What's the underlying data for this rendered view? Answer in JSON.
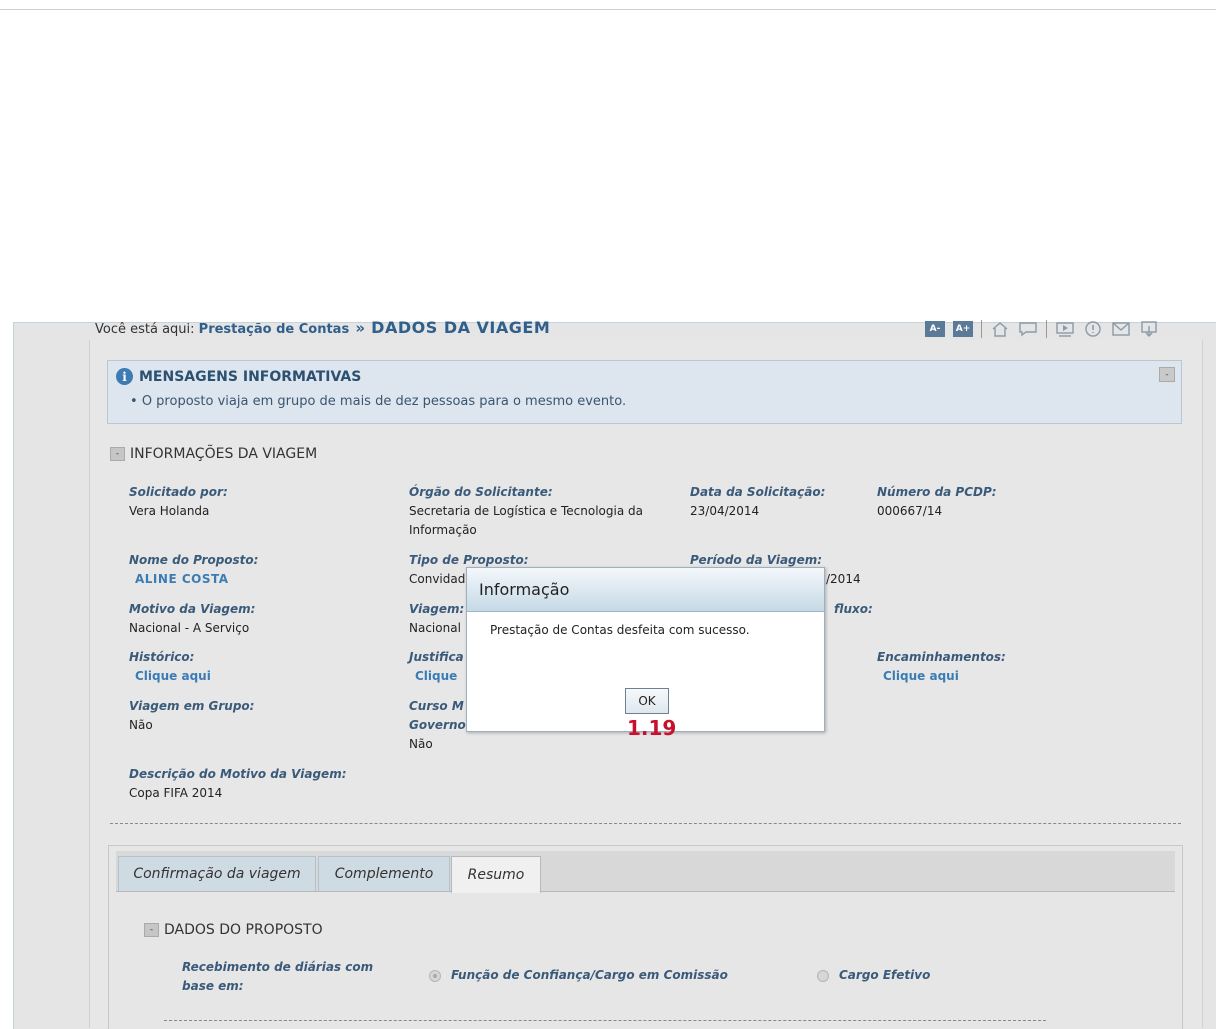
{
  "breadcrumb": {
    "prefix": "Você está aqui:",
    "parent": "Prestação de Contas",
    "separator": "»",
    "current": "DADOS DA VIAGEM"
  },
  "toolbar": {
    "font_decrease": "A-",
    "font_increase": "A+",
    "icons": [
      "home-icon",
      "chat-icon",
      "video-icon",
      "help-icon",
      "mail-icon",
      "exit-icon"
    ]
  },
  "messages": {
    "title": "MENSAGENS INFORMATIVAS",
    "items": [
      "O proposto viaja em grupo de mais de dez pessoas para o mesmo evento."
    ],
    "collapse": "-"
  },
  "trip_info": {
    "header": "INFORMAÇÕES DA VIAGEM",
    "toggle": "-",
    "fields": {
      "solicitado_por": {
        "label": "Solicitado por:",
        "value": "Vera Holanda"
      },
      "orgao": {
        "label": "Órgão do Solicitante:",
        "value_line1": "Secretaria de Logística e Tecnologia da",
        "value_line2": "Informação"
      },
      "data_solicitacao": {
        "label": "Data da Solicitação:",
        "value": "23/04/2014"
      },
      "numero_pcdp": {
        "label": "Número da PCDP:",
        "value": "000667/14"
      },
      "nome_proposto": {
        "label": "Nome do Proposto:",
        "value": "ALINE COSTA"
      },
      "tipo_proposto": {
        "label": "Tipo de Proposto:",
        "value": "Convidad"
      },
      "periodo_viagem": {
        "label": "Período da Viagem:",
        "value": "/2014"
      },
      "motivo_viagem": {
        "label": "Motivo da Viagem:",
        "value": "Nacional - A Serviço"
      },
      "viagem": {
        "label": "Viagem:",
        "value": "Nacional"
      },
      "fluxo": {
        "label": "fluxo:"
      },
      "historico": {
        "label": "Histórico:",
        "link": "Clique aqui"
      },
      "justificativa": {
        "label": "Justifica",
        "link": "Clique"
      },
      "encaminhamentos": {
        "label": "Encaminhamentos:",
        "link": "Clique aqui"
      },
      "viagem_grupo": {
        "label": "Viagem em Grupo:",
        "value": "Não"
      },
      "curso": {
        "label_line1": "Curso M",
        "label_line2": "Governo",
        "value": "Não"
      },
      "descricao_motivo": {
        "label": "Descrição do Motivo da Viagem:",
        "value": "Copa FIFA 2014"
      }
    }
  },
  "tabs": [
    {
      "label": "Confirmação da viagem",
      "active": false
    },
    {
      "label": "Complemento",
      "active": false
    },
    {
      "label": "Resumo",
      "active": true
    }
  ],
  "proposto": {
    "header": "DADOS DO PROPOSTO",
    "toggle": "-",
    "recebimento_label_line1": "Recebimento de diárias com",
    "recebimento_label_line2": "base em:",
    "options": [
      {
        "label": "Função de Confiança/Cargo em Comissão",
        "selected": true
      },
      {
        "label": "Cargo Efetivo",
        "selected": false
      }
    ]
  },
  "dialog": {
    "title": "Informação",
    "message": "Prestação de Contas desfeita com sucesso.",
    "ok": "OK"
  },
  "overlay_label": "1.19"
}
